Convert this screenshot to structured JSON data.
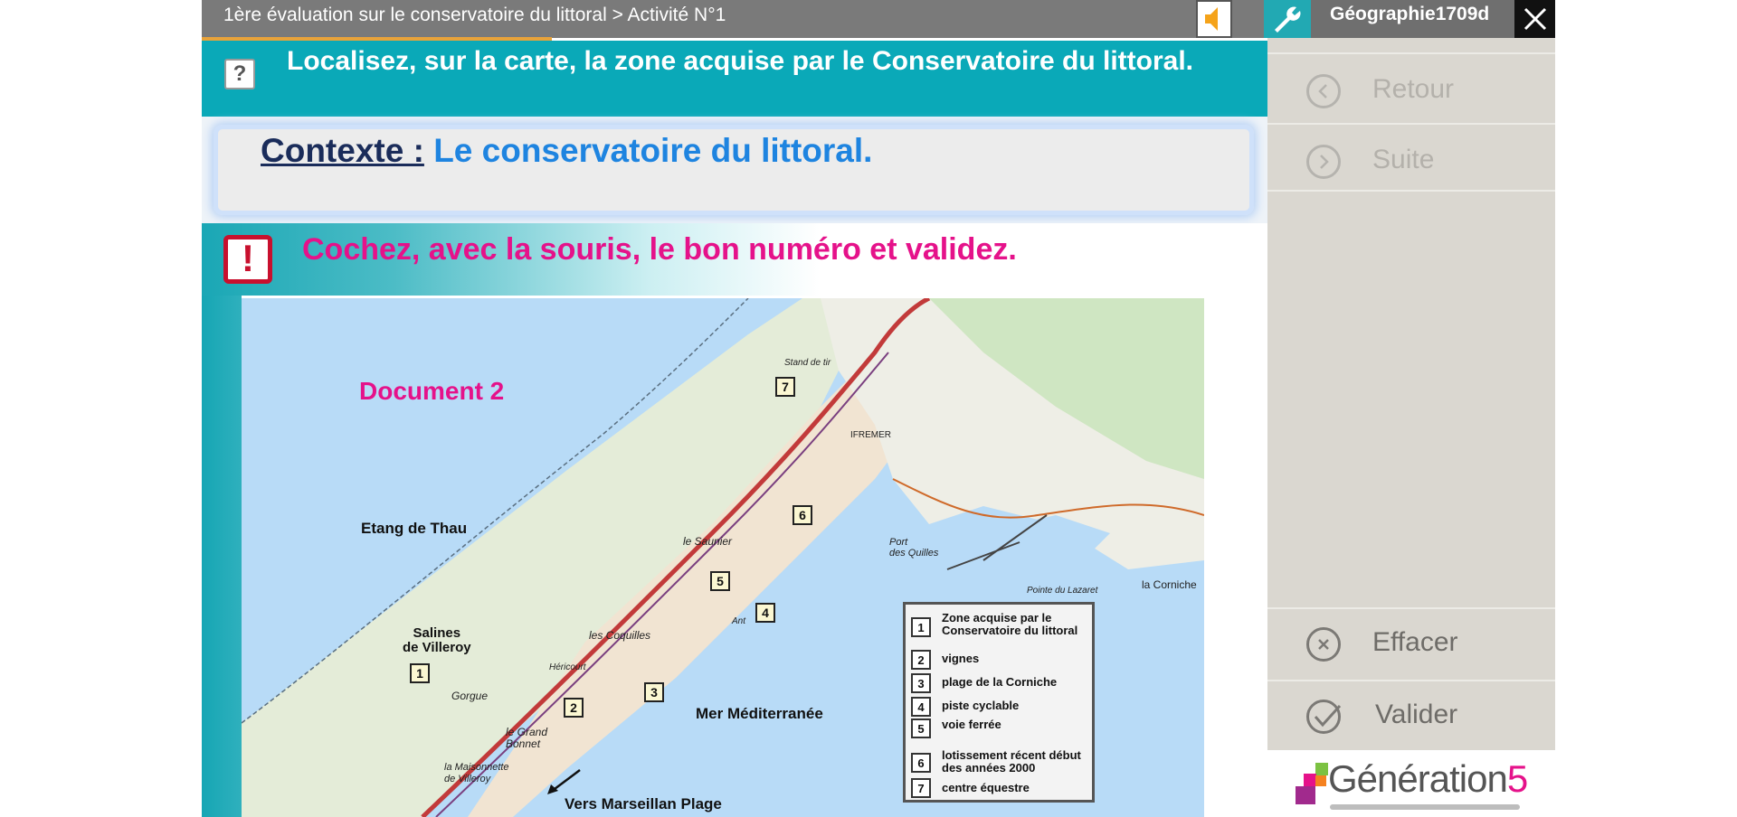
{
  "topbar": {
    "breadcrumb": "1ère évaluation sur le conservatoire du littoral > Activité N°1",
    "sound_icon": "speaker-icon",
    "tool_icon": "wrench-icon",
    "username": "Géographie1709d",
    "close_icon": "close-icon",
    "progress": 0.33
  },
  "question": {
    "icon": "question-icon",
    "text": "Localisez, sur la carte, la zone acquise par le Conservatoire du littoral."
  },
  "context": {
    "label": "Contexte :",
    "value": "Le conservatoire du littoral."
  },
  "instruction": {
    "icon": "exclamation-icon",
    "text": "Cochez, avec la souris, le bon numéro et validez."
  },
  "map": {
    "document_label": "Document 2",
    "place_labels": {
      "etang": "Etang de Thau",
      "salines": "Salines\nde Villeroy",
      "mer": "Mer Méditerranée",
      "marseillan": "Vers Marseillan Plage",
      "corniche": "la Corniche",
      "pointe": "Pointe du Lazaret",
      "port": "Port\ndes Quilles",
      "saunier": "le Saunier",
      "coquilles": "les Coquilles",
      "herault": "Héricourt",
      "gorgue": "Gorgue",
      "grand_bonnet": "le Grand\nBonnet",
      "maisonnette": "la Maisonnette\nde Villeroy",
      "ifremer": "IFREMER",
      "stand": "Stand de tir",
      "ant": "Ant"
    },
    "markers": [
      "1",
      "2",
      "3",
      "4",
      "5",
      "6",
      "7"
    ],
    "legend": [
      {
        "num": "1",
        "text": "Zone acquise par le Conservatoire du littoral"
      },
      {
        "num": "2",
        "text": "vignes"
      },
      {
        "num": "3",
        "text": "plage de la Corniche"
      },
      {
        "num": "4",
        "text": "piste cyclable"
      },
      {
        "num": "5",
        "text": "voie ferrée"
      },
      {
        "num": "6",
        "text": "lotissement récent début des années 2000"
      },
      {
        "num": "7",
        "text": "centre équestre"
      }
    ]
  },
  "sidebar": {
    "retour": "Retour",
    "suite": "Suite",
    "effacer": "Effacer",
    "valider": "Valider"
  },
  "logo": {
    "text": "Génération",
    "number": "5"
  },
  "colors": {
    "teal": "#0aa9b8",
    "magenta": "#e5128a",
    "topbar": "#7a7a7a",
    "panel": "#dad7d0"
  }
}
